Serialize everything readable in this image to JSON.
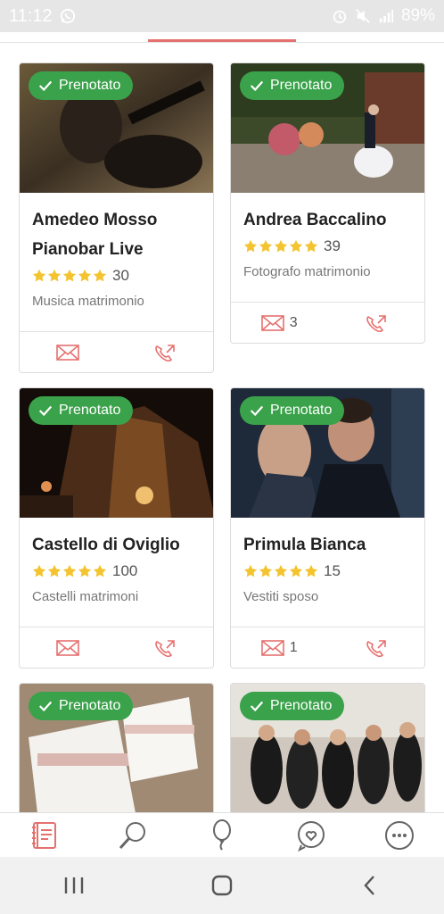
{
  "status_bar": {
    "time": "11:12",
    "battery": "89%",
    "icons": [
      "whatsapp-icon",
      "alarm-icon",
      "mute-icon",
      "signal-icon",
      "battery-icon"
    ]
  },
  "colors": {
    "accent": "#e5716f",
    "badge_green": "#3aa24a",
    "star": "#f4c430"
  },
  "cards": [
    {
      "badge": "Prenotato",
      "title": "Amedeo Mosso Pianobar Live",
      "rating_count": "30",
      "category": "Musica matrimonio",
      "messages": "",
      "image": "guitarist-photo"
    },
    {
      "badge": "Prenotato",
      "title": "Andrea Baccalino",
      "rating_count": "39",
      "category": "Fotografo matrimonio",
      "messages": "3",
      "image": "wedding-couple-photo"
    },
    {
      "badge": "Prenotato",
      "title": "Castello di Oviglio",
      "rating_count": "100",
      "category": "Castelli matrimoni",
      "messages": "",
      "image": "castle-night-photo"
    },
    {
      "badge": "Prenotato",
      "title": "Primula Bianca",
      "rating_count": "15",
      "category": "Vestiti sposo",
      "messages": "1",
      "image": "couple-suits-photo"
    },
    {
      "badge": "Prenotato",
      "image": "invitations-photo"
    },
    {
      "badge": "Prenotato",
      "image": "group-photo"
    }
  ],
  "bottom_nav": [
    "planner-icon",
    "search-icon",
    "balloon-icon",
    "chat-heart-icon",
    "more-icon"
  ]
}
